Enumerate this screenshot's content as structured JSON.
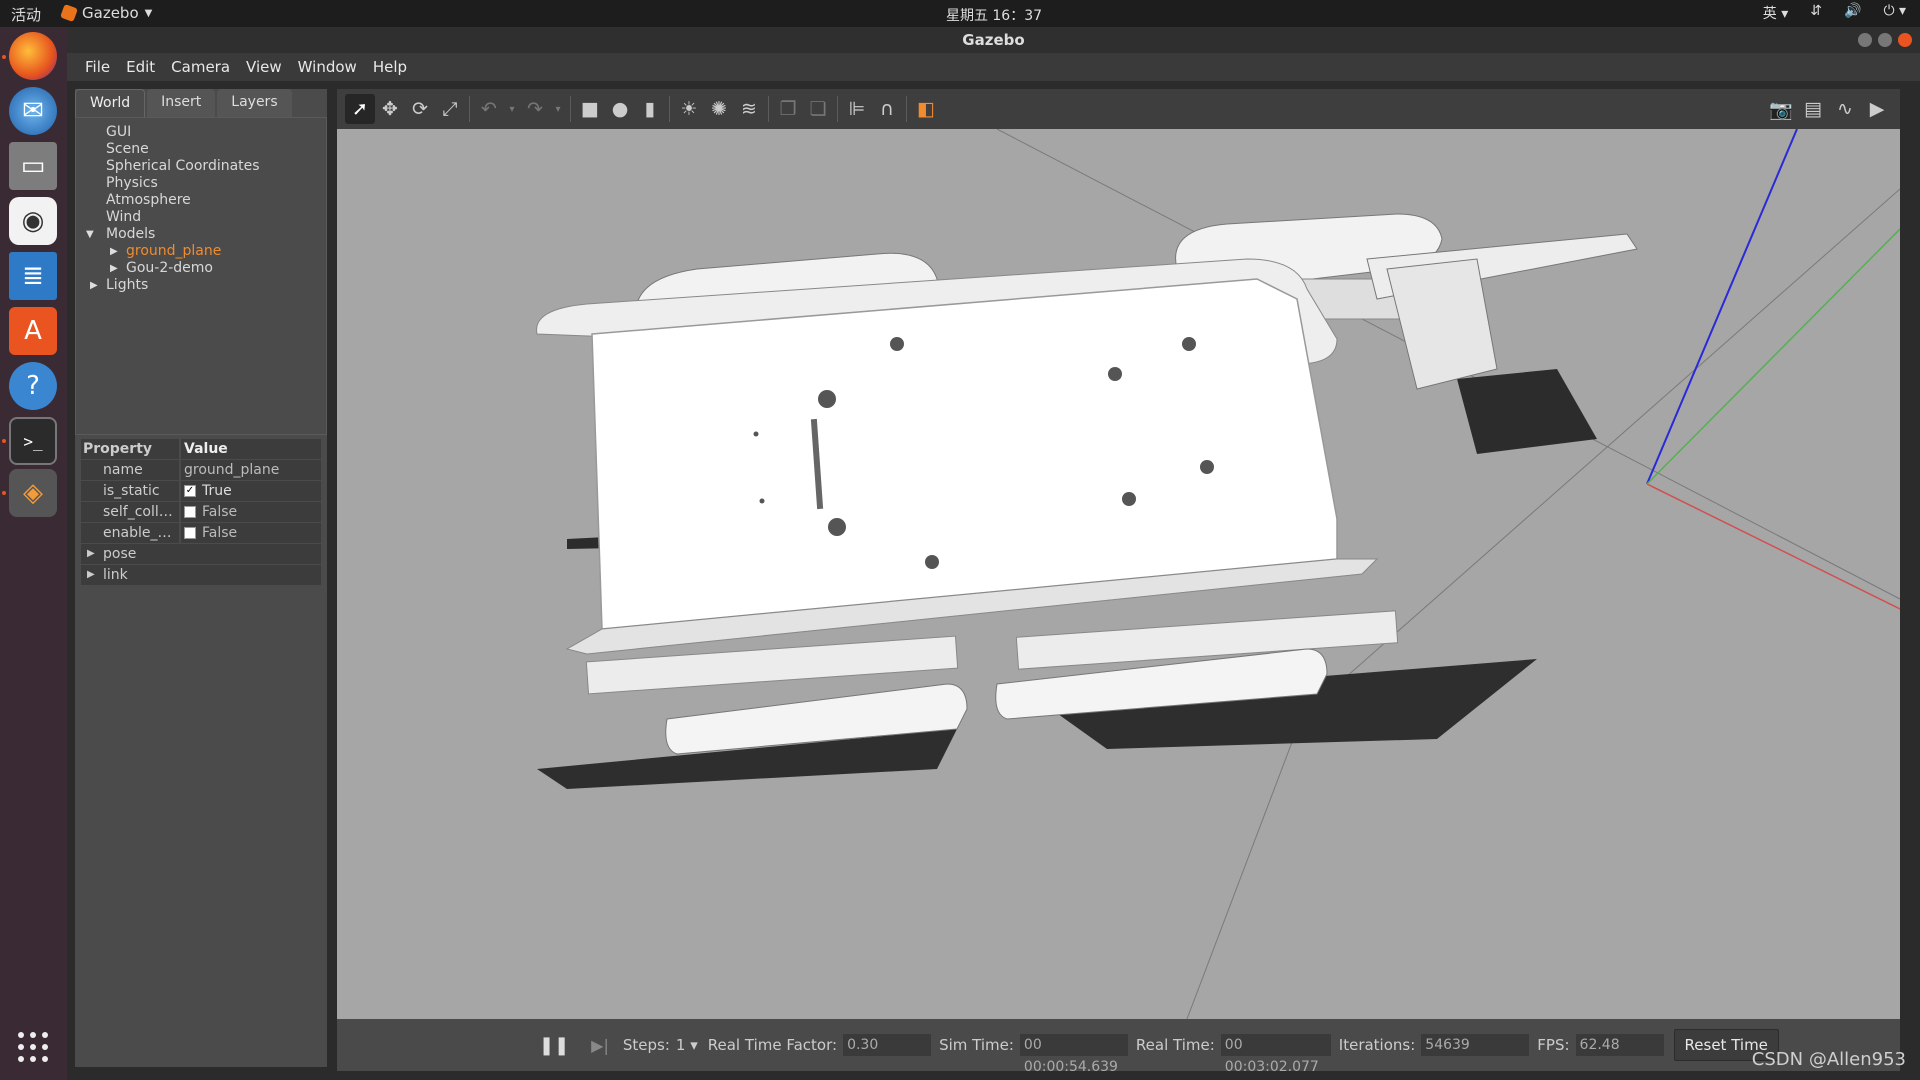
{
  "topbar": {
    "activities": "活动",
    "app_name": "Gazebo",
    "clock": "星期五 16：37",
    "ime": "英"
  },
  "window": {
    "title": "Gazebo"
  },
  "menubar": {
    "items": [
      "File",
      "Edit",
      "Camera",
      "View",
      "Window",
      "Help"
    ]
  },
  "left_panel": {
    "tabs": [
      "World",
      "Insert",
      "Layers"
    ],
    "tree": {
      "gui": "GUI",
      "scene": "Scene",
      "spherical": "Spherical Coordinates",
      "physics": "Physics",
      "atmosphere": "Atmosphere",
      "wind": "Wind",
      "models": "Models",
      "ground_plane": "ground_plane",
      "gou": "Gou-2-demo",
      "lights": "Lights"
    },
    "properties": {
      "header_property": "Property",
      "header_value": "Value",
      "name_key": "name",
      "name_val": "ground_plane",
      "static_key": "is_static",
      "static_val": "True",
      "selfcoll_key": "self_coll…",
      "selfcoll_val": "False",
      "enable_key": "enable_…",
      "enable_val": "False",
      "pose": "pose",
      "link": "link"
    }
  },
  "bottom_bar": {
    "steps_label": "Steps:",
    "steps_value": "1",
    "rtf_label": "Real Time Factor:",
    "rtf_value": "0.30",
    "sim_label": "Sim Time:",
    "sim_value": "00 00:00:54.639",
    "real_label": "Real Time:",
    "real_value": "00 00:03:02.077",
    "iter_label": "Iterations:",
    "iter_value": "54639",
    "fps_label": "FPS:",
    "fps_value": "62.48",
    "reset": "Reset Time"
  },
  "watermark": "CSDN @Allen953",
  "colors": {
    "accent": "#e95420",
    "selected_tree": "#f08b2f",
    "viewport_bg": "#a6a6a6"
  }
}
